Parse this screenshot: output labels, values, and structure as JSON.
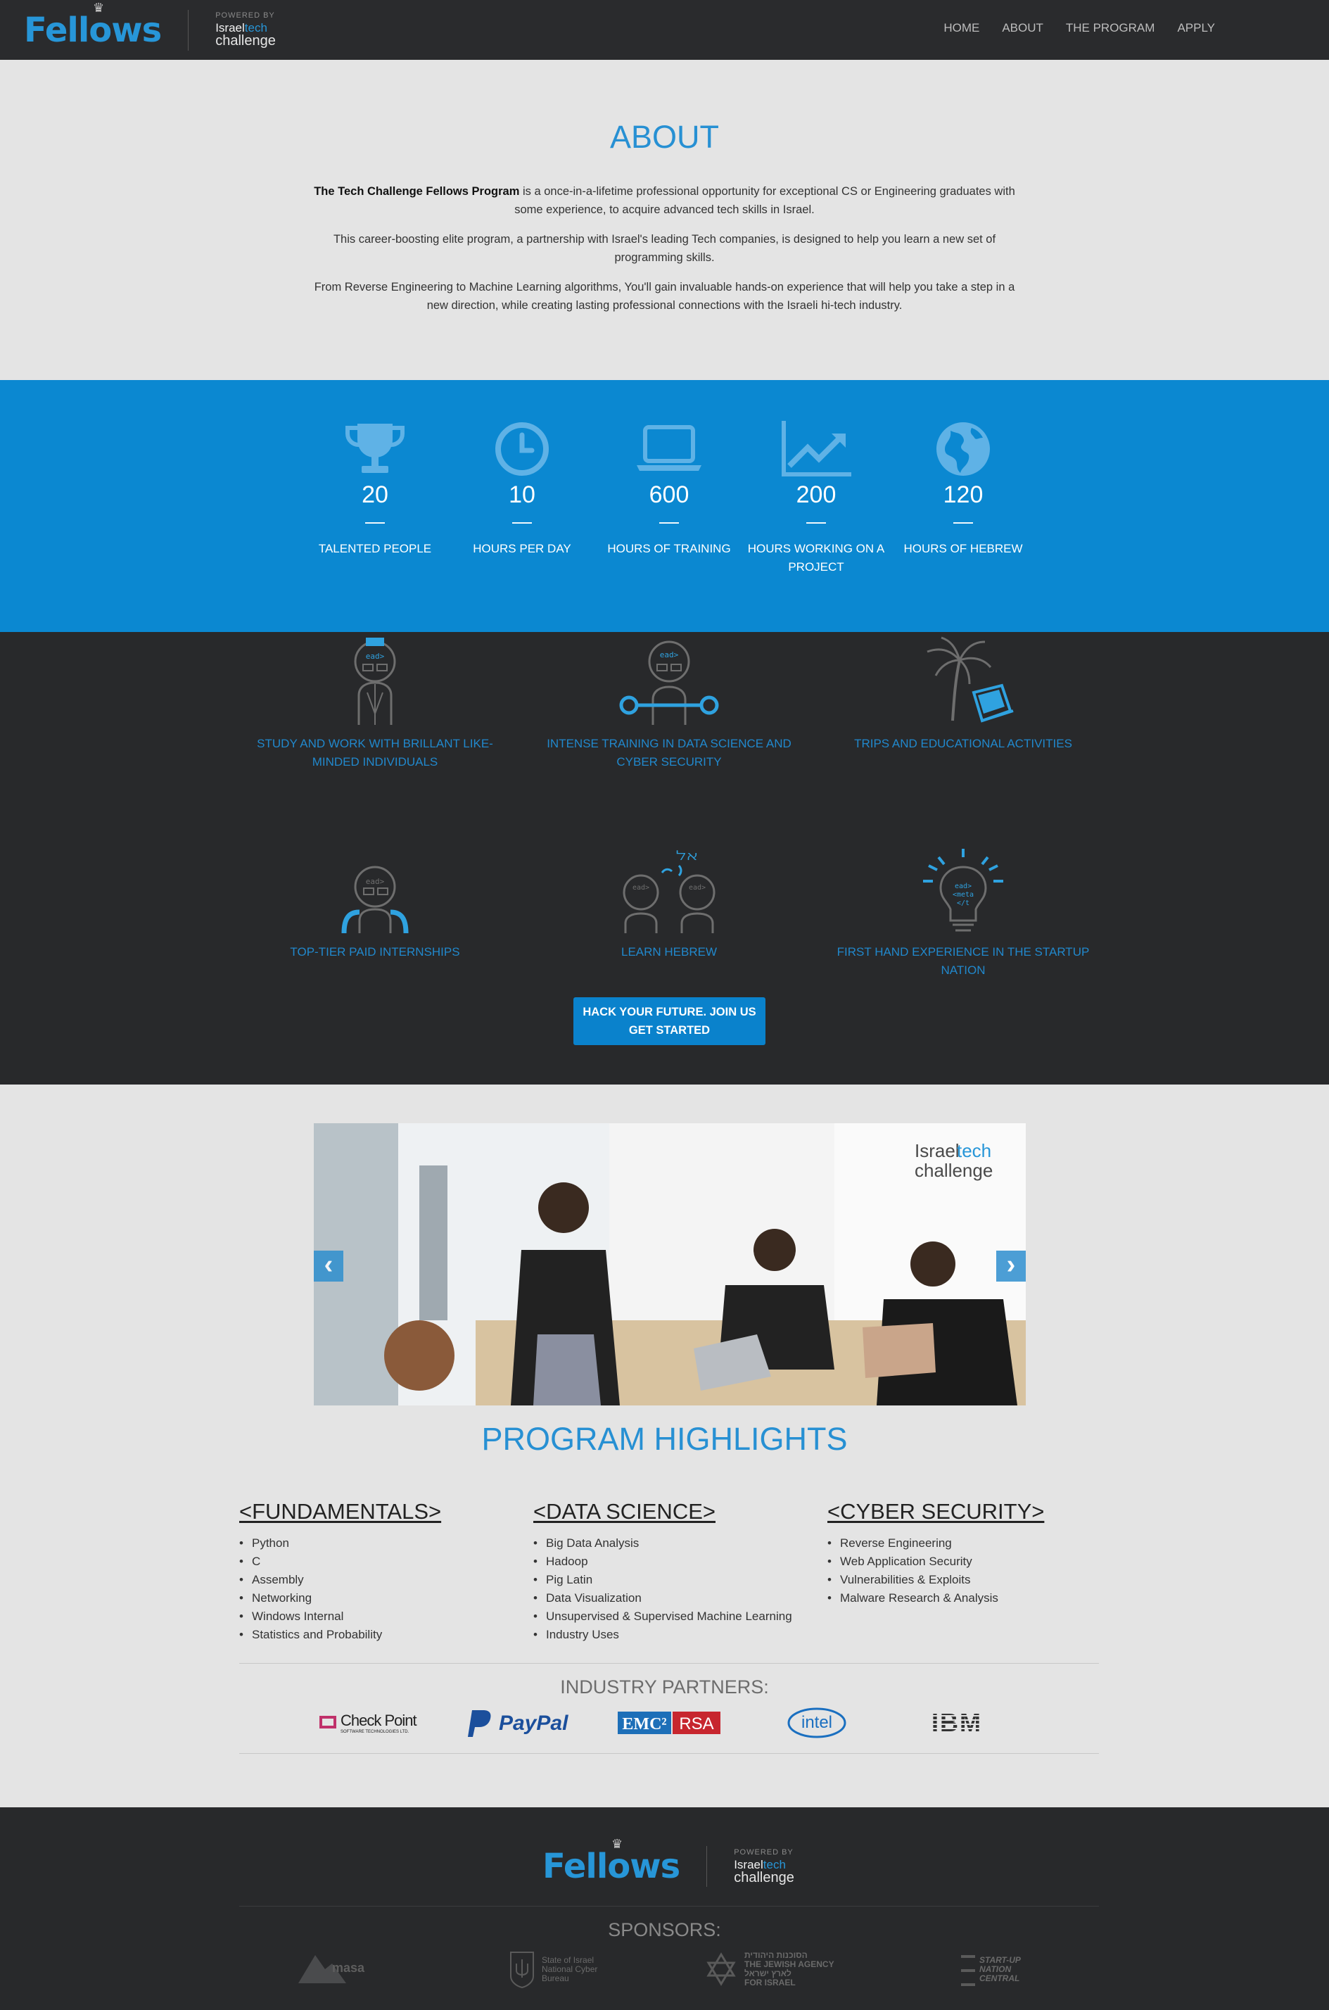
{
  "header": {
    "logo_text": "Fellows",
    "powered_by": "POWERED BY",
    "itc_israel": "Israel",
    "itc_tech": "tech",
    "itc_challenge": "challenge",
    "nav": [
      "HOME",
      "ABOUT",
      "THE PROGRAM",
      "APPLY"
    ]
  },
  "about": {
    "title": "ABOUT",
    "p1_bold": "The Tech Challenge Fellows Program",
    "p1_rest": " is a once-in-a-lifetime professional opportunity for exceptional CS or Engineering graduates with some experience, to acquire advanced tech skills in Israel.",
    "p2": "This career-boosting elite program, a partnership with Israel's leading Tech companies, is designed to help you learn a new set of programming skills.",
    "p3": "From Reverse Engineering to Machine Learning algorithms, You'll gain invaluable hands-on experience that will help you take a step in a new direction, while creating lasting professional connections with the Israeli hi-tech industry."
  },
  "stats": [
    {
      "icon": "trophy-icon",
      "value": "20",
      "dash": "—",
      "label": "TALENTED PEOPLE"
    },
    {
      "icon": "clock-icon",
      "value": "10",
      "dash": "—",
      "label": "HOURS PER DAY"
    },
    {
      "icon": "laptop-icon",
      "value": "600",
      "dash": "—",
      "label": "HOURS OF TRAINING"
    },
    {
      "icon": "chart-icon",
      "value": "200",
      "dash": "—",
      "label": "HOURS WORKING ON A PROJECT"
    },
    {
      "icon": "globe-icon",
      "value": "120",
      "dash": "—",
      "label": "HOURS OF HEBREW"
    }
  ],
  "features": [
    {
      "label": "STUDY AND WORK WITH BRILLANT LIKE-MINDED INDIVIDUALS"
    },
    {
      "label": "INTENSE TRAINING IN DATA SCIENCE AND CYBER SECURITY"
    },
    {
      "label": "TRIPS AND EDUCATIONAL ACTIVITIES"
    },
    {
      "label": "TOP-TIER PAID INTERNSHIPS"
    },
    {
      "label": "LEARN HEBREW"
    },
    {
      "label": "FIRST HAND EXPERIENCE IN THE STARTUP NATION"
    }
  ],
  "cta": {
    "line1": "HACK YOUR FUTURE. JOIN US",
    "line2": "GET STARTED"
  },
  "carousel": {
    "badge_israel": "Israel",
    "badge_tech": "tech",
    "badge_challenge": "challenge",
    "prev": "‹",
    "next": "›"
  },
  "highlights": {
    "title": "PROGRAM HIGHLIGHTS",
    "columns": [
      {
        "heading": "<FUNDAMENTALS>",
        "items": [
          "Python",
          "C",
          "Assembly",
          "Networking",
          "Windows Internal",
          "Statistics and Probability"
        ]
      },
      {
        "heading": "<DATA SCIENCE>",
        "items": [
          "Big Data Analysis",
          "Hadoop",
          "Pig Latin",
          "Data Visualization",
          "Unsupervised & Supervised Machine Learning",
          "Industry Uses"
        ]
      },
      {
        "heading": "<CYBER SECURITY>",
        "items": [
          "Reverse Engineering",
          "Web Application Security",
          "Vulnerabilities & Exploits",
          "Malware Research & Analysis"
        ]
      }
    ]
  },
  "partners": {
    "title": "INDUSTRY PARTNERS:",
    "checkpoint": "Check Point",
    "checkpoint_sub": "SOFTWARE TECHNOLOGIES LTD.",
    "paypal": "PayPal",
    "emc": "EMC²",
    "rsa": "RSA",
    "intel": "intel",
    "ibm": "IBM"
  },
  "footer": {
    "logo_text": "Fellows",
    "powered_by": "POWERED BY",
    "itc_israel": "Israel",
    "itc_tech": "tech",
    "itc_challenge": "challenge",
    "sponsors_title": "SPONSORS:",
    "masa": "masa",
    "cyber_l1": "State of Israel",
    "cyber_l2": "National Cyber",
    "cyber_l3": "Bureau",
    "ja_l1": "THE JEWISH AGENCY",
    "ja_l2": "FOR ISRAEL",
    "ja_he1": "הסוכנות היהודית",
    "ja_he2": "לארץ ישראל",
    "snc_l1": "START-UP",
    "snc_l2": "NATION",
    "snc_l3": "CENTRAL"
  }
}
